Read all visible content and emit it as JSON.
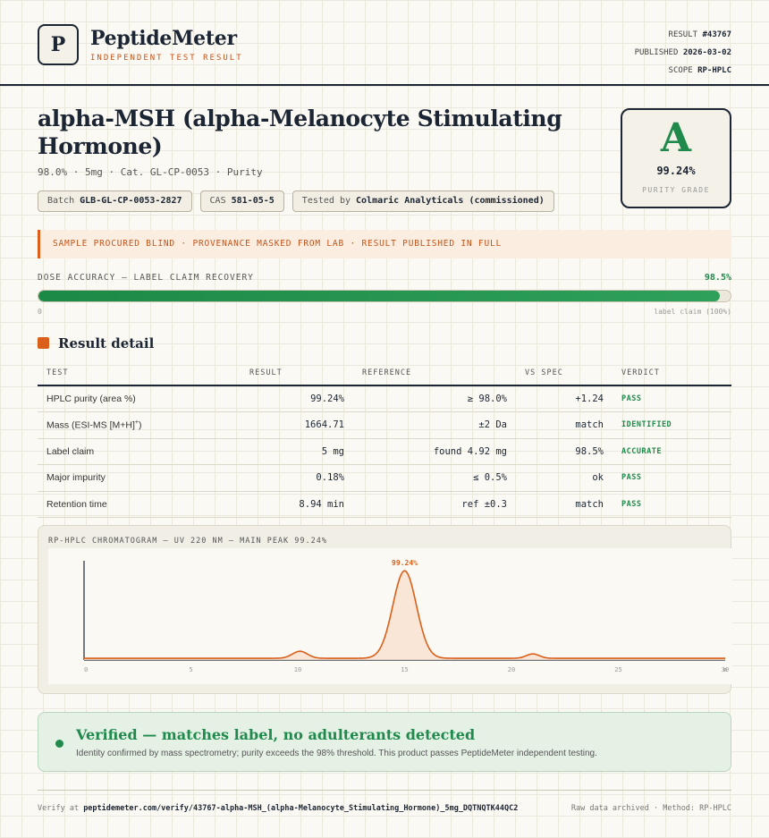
{
  "header": {
    "logo_letter": "P",
    "brand": "PeptideMeter",
    "tagline": "INDEPENDENT TEST RESULT",
    "result_label": "RESULT",
    "result_id": "#43767",
    "published_label": "PUBLISHED",
    "published_date": "2026-03-02",
    "scope_label": "SCOPE",
    "scope_value": "RP-HPLC"
  },
  "product": {
    "title": "alpha-MSH (alpha-Melanocyte Stimulating Hormone)",
    "subline": "98.0% · 5mg · Cat. GL-CP-0053 · Purity",
    "batch_label": "Batch",
    "batch_value": "GLB-GL-CP-0053-2827",
    "cas_label": "CAS",
    "cas_value": "581-05-5",
    "tested_label": "Tested by",
    "tested_value": "Colmaric Analyticals (commissioned)"
  },
  "grade": {
    "letter": "A",
    "value": "99.24%",
    "label": "PURITY GRADE"
  },
  "banner": "SAMPLE PROCURED BLIND · PROVENANCE MASKED FROM LAB · RESULT PUBLISHED IN FULL",
  "dose": {
    "label": "DOSE ACCURACY — LABEL CLAIM RECOVERY",
    "value_text": "98.5%",
    "fraction": 0.985,
    "min_label": "0",
    "max_label": "label claim (100%)"
  },
  "section_title": "Result detail",
  "table": {
    "headers": [
      "TEST",
      "RESULT",
      "REFERENCE",
      "VS SPEC",
      "VERDICT"
    ],
    "rows": [
      {
        "test": "HPLC purity (area %)",
        "result": "99.24%",
        "reference": "≥ 98.0%",
        "vs_spec": "+1.24",
        "verdict": "PASS"
      },
      {
        "test": "Mass (ESI-MS [M+H]",
        "test_sup": "+",
        "test_end": ")",
        "result": "1664.71",
        "reference": "±2 Da",
        "vs_spec": "match",
        "verdict": "IDENTIFIED"
      },
      {
        "test": "Label claim",
        "result": "5 mg",
        "reference": "found 4.92 mg",
        "vs_spec": "98.5%",
        "verdict": "ACCURATE"
      },
      {
        "test": "Major impurity",
        "result": "0.18%",
        "reference": "≤ 0.5%",
        "vs_spec": "ok",
        "verdict": "PASS"
      },
      {
        "test": "Retention time",
        "result": "8.94 min",
        "reference": "ref ±0.3",
        "vs_spec": "match",
        "verdict": "PASS"
      }
    ]
  },
  "chart_data": {
    "type": "line",
    "title": "RP-HPLC CHROMATOGRAM — UV 220 NM — MAIN PEAK 99.24%",
    "xlim": [
      0,
      30
    ],
    "x_ticks": [
      "0",
      "5",
      "10",
      "15",
      "20",
      "25",
      "30"
    ],
    "x_unit_label": "m",
    "peaks": [
      {
        "x": 10.1,
        "height": 0.08,
        "width": 0.35
      },
      {
        "x": 15.0,
        "height": 1.0,
        "width": 0.55
      },
      {
        "x": 21.0,
        "height": 0.05,
        "width": 0.3
      }
    ],
    "baseline": 0.02,
    "peak_label": "99.24%",
    "line_color": "#d95f1a",
    "fill_color": "#f9e1cf"
  },
  "verified": {
    "title": "Verified — matches label, no adulterants detected",
    "subtitle": "Identity confirmed by mass spectrometry; purity exceeds the 98% threshold. This product passes PeptideMeter independent testing."
  },
  "footer": {
    "verify_label": "Verify at",
    "verify_url": "peptidemeter.com/verify/43767-alpha-MSH_(alpha-Melanocyte_Stimulating_Hormone)_5mg_DQTNQTK44QC2",
    "right_text": "Raw data archived · Method: RP-HPLC"
  },
  "colors": {
    "accent": "#d95f1a",
    "pass": "#1f8a4c",
    "ink": "#1c2533"
  }
}
